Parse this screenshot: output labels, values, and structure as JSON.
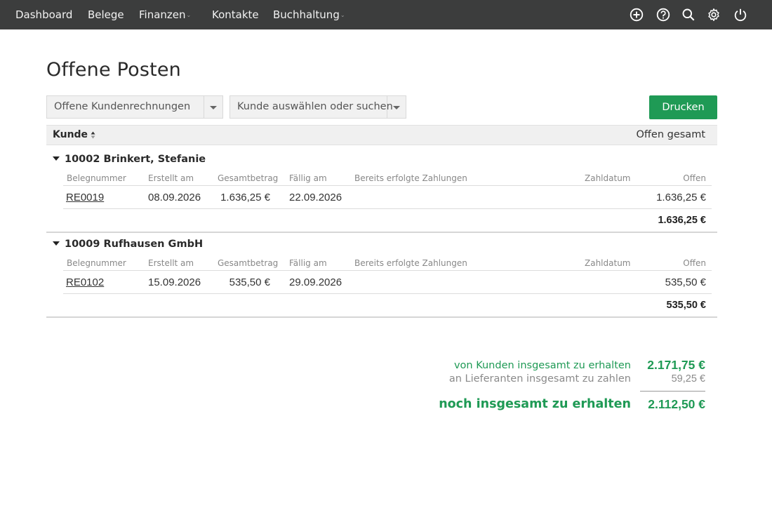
{
  "nav": {
    "items": [
      {
        "label": "Dashboard"
      },
      {
        "label": "Belege"
      },
      {
        "label": "Finanzen",
        "caret": "⌄"
      },
      {
        "label": "Kontakte"
      },
      {
        "label": "Buchhaltung",
        "caret": "⌄"
      }
    ],
    "icons": [
      "add-icon",
      "help-icon",
      "search-icon",
      "gear-icon",
      "power-icon"
    ]
  },
  "page": {
    "title": "Offene Posten"
  },
  "filters": {
    "type_select": "Offene Kundenrechnungen",
    "customer_select": "Kunde auswählen oder suchen"
  },
  "actions": {
    "print_label": "Drucken"
  },
  "table": {
    "col_customer": "Kunde",
    "col_open_total": "Offen gesamt",
    "columns": [
      "Belegnummer",
      "Erstellt am",
      "Gesamtbetrag",
      "Fällig am",
      "Bereits erfolgte Zahlungen",
      "Zahldatum",
      "Offen"
    ],
    "groups": [
      {
        "title": "10002 Brinkert, Stefanie",
        "rows": [
          {
            "number": "RE0019",
            "created": "08.09.2026",
            "total": "1.636,25 €",
            "due": "22.09.2026",
            "payments": "",
            "paid_date": "",
            "open": "1.636,25 €"
          }
        ],
        "subtotal": "1.636,25 €"
      },
      {
        "title": "10009 Rufhausen GmbH",
        "rows": [
          {
            "number": "RE0102",
            "created": "15.09.2026",
            "total": "535,50 €",
            "due": "29.09.2026",
            "payments": "",
            "paid_date": "",
            "open": "535,50 €"
          }
        ],
        "subtotal": "535,50 €"
      }
    ]
  },
  "summary": {
    "receive_label": "von Kunden insgesamt zu erhalten",
    "receive_value": "2.171,75 €",
    "pay_label": "an Lieferanten insgesamt zu zahlen",
    "pay_value": "59,25 €",
    "net_label": "noch insgesamt zu erhalten",
    "net_value": "2.112,50 €"
  },
  "colors": {
    "accent": "#1f9a55",
    "topbar": "#3c3d3d"
  }
}
